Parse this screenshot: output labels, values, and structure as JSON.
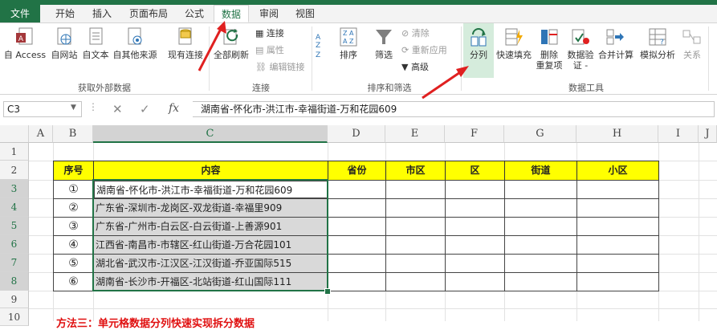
{
  "ribbon_tabs": [
    "文件",
    "开始",
    "插入",
    "页面布局",
    "公式",
    "数据",
    "审阅",
    "视图"
  ],
  "get_external": {
    "buttons": [
      "自 Access",
      "自网站",
      "自文本",
      "自其他来源",
      "现有连接"
    ],
    "group_label": "获取外部数据"
  },
  "connections": {
    "refresh_all": "全部刷新",
    "connect": "连接",
    "properties": "属性",
    "edit_links": "编辑链接",
    "group_label": "连接"
  },
  "sort_filter": {
    "sort": "排序",
    "filter": "筛选",
    "clear": "清除",
    "reapply": "重新应用",
    "advanced": "高级",
    "group_label": "排序和筛选"
  },
  "data_tools": {
    "text_to_columns": "分列",
    "flash_fill": "快速填充",
    "remove_dup_1": "删除",
    "remove_dup_2": "重复项",
    "validation_1": "数据验",
    "validation_2": "证 -",
    "consolidate": "合并计算",
    "what_if": "模拟分析",
    "relations": "关系",
    "group_label": "数据工具"
  },
  "formula_bar": {
    "name_box": "C3",
    "cancel": "✕",
    "enter": "✓",
    "fx": "fx",
    "value": "湖南省-怀化市-洪江市-幸福街道-万和花园609"
  },
  "columns": [
    "A",
    "B",
    "C",
    "D",
    "E",
    "F",
    "G",
    "H",
    "I",
    "J"
  ],
  "rows": [
    "1",
    "2",
    "3",
    "4",
    "5",
    "6",
    "7",
    "8",
    "9",
    "10"
  ],
  "table": {
    "headers": [
      "序号",
      "内容",
      "省份",
      "市区",
      "区",
      "街道",
      "小区"
    ],
    "numbers": [
      "①",
      "②",
      "③",
      "④",
      "⑤",
      "⑥"
    ],
    "contents": [
      "湖南省-怀化市-洪江市-幸福街道-万和花园609",
      "广东省-深圳市-龙岗区-双龙街道-幸福里909",
      "广东省-广州市-白云区-白云街道-上善源901",
      "江西省-南昌市-市辖区-红山街道-万合花园101",
      "湖北省-武汉市-江汉区-江汉街道-乔亚国际515",
      "湖南省-长沙市-开福区-北站街道-红山国际111"
    ]
  },
  "note": "方法三：单元格数据分列快速实现拆分数据",
  "colors": {
    "excel_green": "#217346",
    "header_yellow": "#ffff00",
    "arrow_red": "#e02020"
  }
}
